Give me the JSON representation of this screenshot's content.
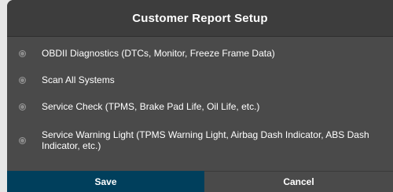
{
  "dialog": {
    "title": "Customer Report Setup"
  },
  "options": [
    {
      "label": "OBDII Diagnostics (DTCs, Monitor, Freeze Frame Data)"
    },
    {
      "label": "Scan All Systems"
    },
    {
      "label": "Service Check (TPMS, Brake Pad Life, Oil Life, etc.)"
    },
    {
      "label": "Service Warning Light (TPMS Warning Light, Airbag Dash Indicator, ABS Dash Indicator, etc.)"
    }
  ],
  "footer": {
    "save_label": "Save",
    "cancel_label": "Cancel"
  },
  "colors": {
    "dialog_bg": "#4a4a4a",
    "header_bg": "#3d3d3d",
    "save_bg": "#003f5c",
    "text": "#ffffff"
  }
}
